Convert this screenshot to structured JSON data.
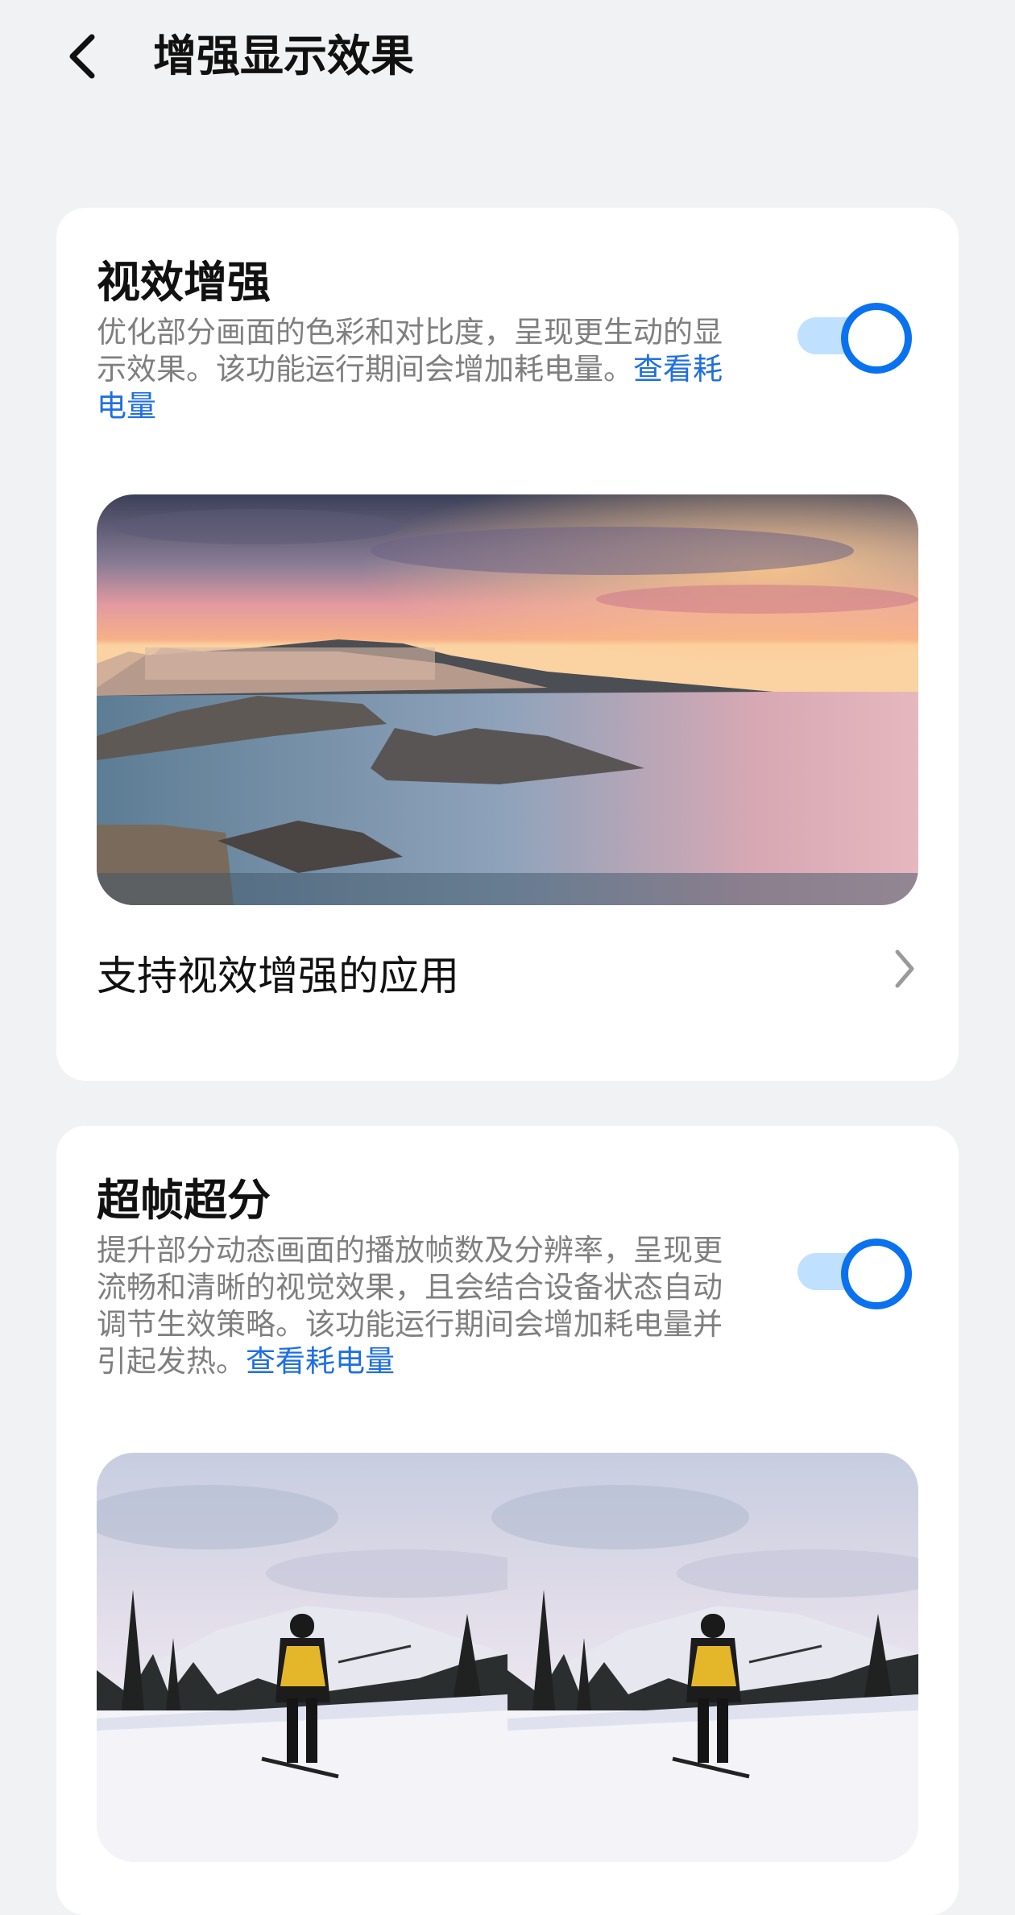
{
  "header": {
    "title": "增强显示效果"
  },
  "visual_enhance": {
    "title": "视效增强",
    "description": "优化部分画面的色彩和对比度，呈现更生动的显示效果。该功能运行期间会增加耗电量。",
    "link": "查看耗电量",
    "enabled": true,
    "supported_apps_label": "支持视效增强的应用"
  },
  "super_frame": {
    "title": "超帧超分",
    "description": "提升部分动态画面的播放帧数及分辨率，呈现更流畅和清晰的视觉效果，且会结合设备状态自动调节生效策略。该功能运行期间会增加耗电量并引起发热。",
    "link": "查看耗电量",
    "enabled": true
  },
  "colors": {
    "accent": "#0a72ef",
    "link": "#1f6fe0",
    "background": "#f1f2f4"
  },
  "icons": [
    "back-icon",
    "chevron-right-icon"
  ]
}
